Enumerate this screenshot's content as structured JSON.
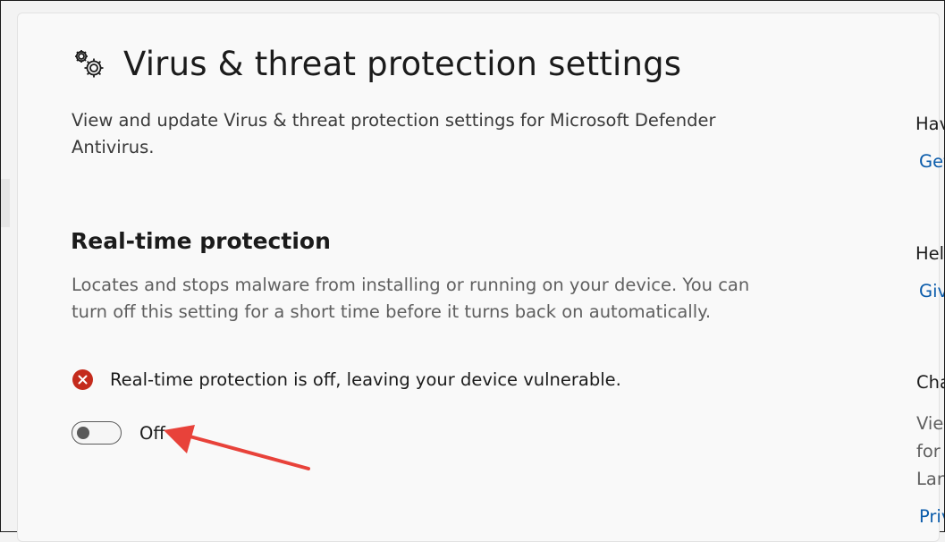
{
  "header": {
    "title": "Virus & threat protection settings",
    "description": "View and update Virus & threat protection settings for Microsoft Defender Antivirus.",
    "icon": "gears-icon"
  },
  "realtime": {
    "heading": "Real-time protection",
    "description": "Locates and stops malware from installing or running on your device. You can turn off this setting for a short time before it turns back on automatically.",
    "status_text": "Real-time protection is off, leaving your device vulnerable.",
    "status_icon": "error-icon",
    "status_color": "#c42b1c",
    "toggle_state": "off",
    "toggle_label": "Off"
  },
  "annotation": {
    "arrow_color": "#e8423a"
  },
  "side_panel": {
    "items": [
      {
        "text": "Hav",
        "kind": "heading"
      },
      {
        "text": "Get",
        "kind": "link"
      },
      {
        "text": "Hel",
        "kind": "heading"
      },
      {
        "text": "Giv",
        "kind": "link"
      },
      {
        "text": "Cha",
        "kind": "heading"
      },
      {
        "text": "Vie",
        "kind": "text"
      },
      {
        "text": "for",
        "kind": "text"
      },
      {
        "text": "Lan",
        "kind": "text"
      },
      {
        "text": "Priv",
        "kind": "link"
      }
    ]
  },
  "colors": {
    "link": "#0b5cab",
    "background": "#f3f3f3",
    "card": "#f9f9f9"
  }
}
